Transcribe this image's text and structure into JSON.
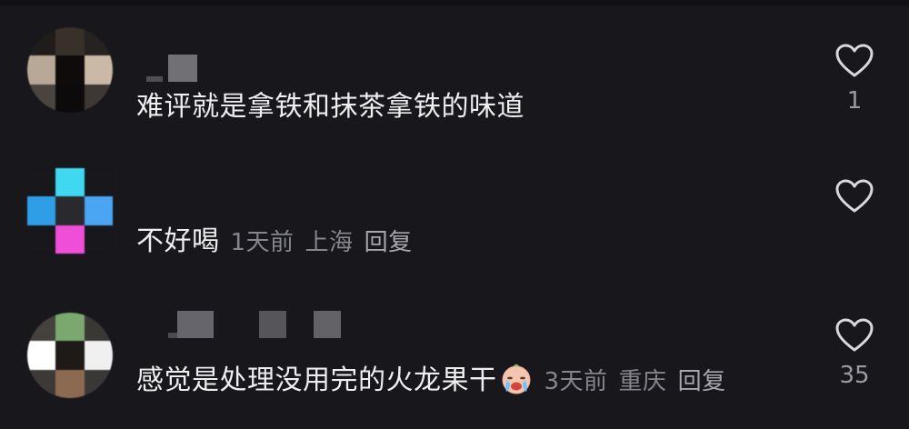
{
  "comments": [
    {
      "text": "难评就是拿铁和抹茶拿铁的味道",
      "time": "",
      "location": "",
      "reply": "",
      "likes": "1",
      "avatar_colors": [
        "#201c1a",
        "#3a302a",
        "#262220",
        "#b8a898",
        "#0e0b0a",
        "#c9b9a6",
        "#4a4440",
        "#0c0a0a",
        "#3d3834"
      ]
    },
    {
      "text": "不好喝",
      "time": "1天前",
      "location": "上海",
      "reply": "回复",
      "likes": "",
      "avatar_colors": [
        "#17171c",
        "#3fd8f0",
        "#17171c",
        "#2f9ee6",
        "#29292e",
        "#4aa6f2",
        "#17171c",
        "#ee4ed8",
        "#17171c"
      ]
    },
    {
      "text": "感觉是处理没用完的火龙果干",
      "time": "3天前",
      "location": "重庆",
      "reply": "回复",
      "likes": "35",
      "emoji": "crying-face-emoji",
      "avatar_colors": [
        "#45423e",
        "#7aa86e",
        "#3a3835",
        "#ffffff",
        "#1e1a18",
        "#f0f0f0",
        "#3c3936",
        "#8c6a52",
        "#3a3836"
      ]
    }
  ],
  "icons": {
    "like": "heart-outline-icon"
  },
  "colors": {
    "background": "#17171c",
    "text": "#eeeeee",
    "meta": "#85858c"
  }
}
